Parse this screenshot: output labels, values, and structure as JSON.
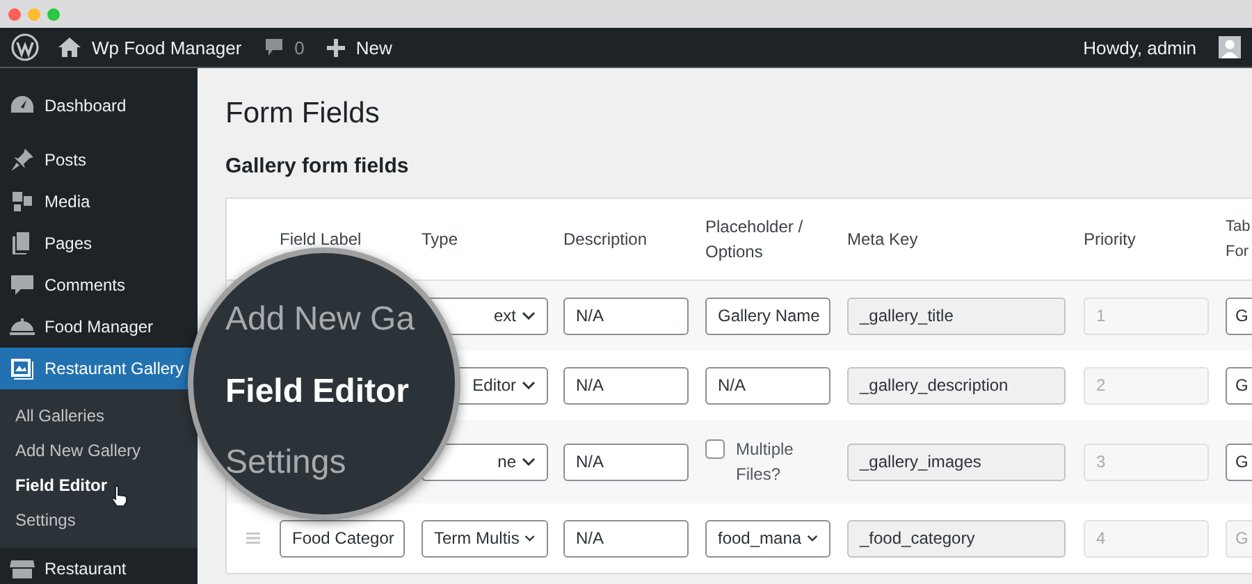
{
  "admin_bar": {
    "site_name": "Wp Food Manager",
    "comments_count": "0",
    "new_label": "New",
    "greeting": "Howdy, admin"
  },
  "sidebar": {
    "items": [
      {
        "label": "Dashboard",
        "selected": false
      },
      {
        "label": "Posts",
        "selected": false
      },
      {
        "label": "Media",
        "selected": false
      },
      {
        "label": "Pages",
        "selected": false
      },
      {
        "label": "Comments",
        "selected": false
      },
      {
        "label": "Food Manager",
        "selected": false
      },
      {
        "label": "Restaurant Gallery",
        "selected": true,
        "children": [
          {
            "label": "All Galleries",
            "selected": false
          },
          {
            "label": "Add New Gallery",
            "selected": false
          },
          {
            "label": "Field Editor",
            "selected": true
          },
          {
            "label": "Settings",
            "selected": false
          }
        ]
      },
      {
        "label": "Restaurant",
        "selected": false
      }
    ]
  },
  "magnifier": {
    "items": [
      {
        "label": "Add New Ga",
        "selected": false
      },
      {
        "label": "Field Editor",
        "selected": true
      },
      {
        "label": "Settings",
        "selected": false
      }
    ]
  },
  "page": {
    "title": "Form Fields",
    "section_title": "Gallery form fields"
  },
  "table": {
    "columns": [
      "Field Label",
      "Type",
      "Description",
      "Placeholder / Options",
      "Meta Key",
      "Priority",
      "Tab For"
    ],
    "rows": [
      {
        "type": "ext",
        "description": "N/A",
        "placeholder": {
          "kind": "text",
          "value": "Gallery Name"
        },
        "meta_key": "_gallery_title",
        "priority": "1",
        "tab_form": "G",
        "tab_form_disabled": false
      },
      {
        "type": "Editor",
        "description": "N/A",
        "placeholder": {
          "kind": "text",
          "value": "N/A"
        },
        "meta_key": "_gallery_description",
        "priority": "2",
        "tab_form": "G",
        "tab_form_disabled": false
      },
      {
        "type": "ne",
        "description": "N/A",
        "placeholder": {
          "kind": "checkbox",
          "label": "Multiple Files?",
          "checked": false
        },
        "meta_key": "_gallery_images",
        "priority": "3",
        "tab_form": "G",
        "tab_form_disabled": false
      },
      {
        "label": "Food Categor",
        "type": "Term Multis",
        "description": "N/A",
        "placeholder": {
          "kind": "select",
          "value": "food_mana"
        },
        "meta_key": "_food_category",
        "priority": "4",
        "tab_form": "G",
        "tab_form_disabled": true
      }
    ]
  }
}
